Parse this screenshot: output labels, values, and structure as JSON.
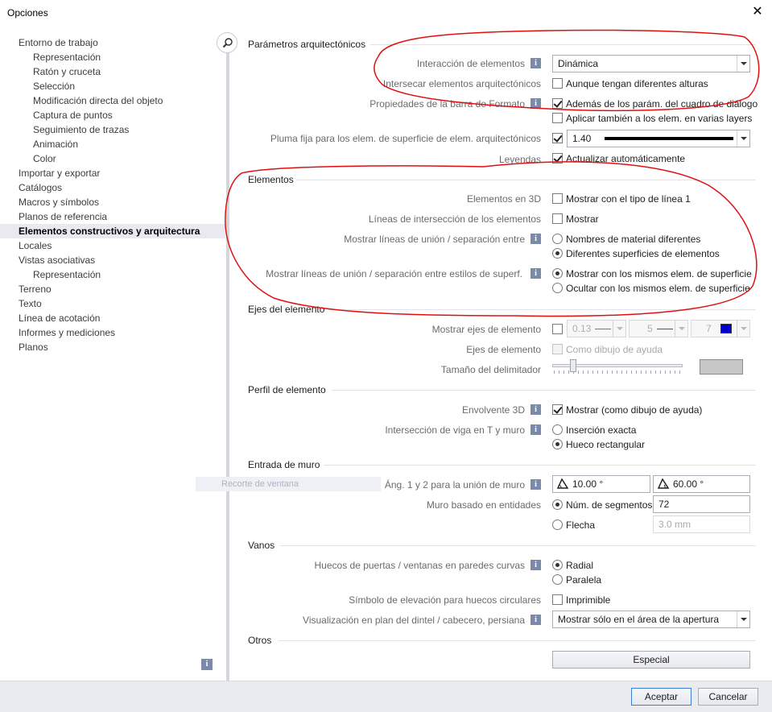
{
  "window": {
    "title": "Opciones",
    "close_glyph": "✕"
  },
  "nav": {
    "items": [
      {
        "label": "Entorno de trabajo",
        "level": 1
      },
      {
        "label": "Representación",
        "level": 2
      },
      {
        "label": "Ratón y cruceta",
        "level": 2
      },
      {
        "label": "Selección",
        "level": 2
      },
      {
        "label": "Modificación directa del objeto",
        "level": 2
      },
      {
        "label": "Captura de puntos",
        "level": 2
      },
      {
        "label": "Seguimiento de trazas",
        "level": 2
      },
      {
        "label": "Animación",
        "level": 2
      },
      {
        "label": "Color",
        "level": 2
      },
      {
        "label": "Importar y exportar",
        "level": 1
      },
      {
        "label": "Catálogos",
        "level": 1
      },
      {
        "label": "Macros y símbolos",
        "level": 1
      },
      {
        "label": "Planos de referencia",
        "level": 1
      },
      {
        "label": "Elementos constructivos y arquitectura",
        "level": 1,
        "selected": true
      },
      {
        "label": "Locales",
        "level": 1
      },
      {
        "label": "Vistas asociativas",
        "level": 1
      },
      {
        "label": "Representación",
        "level": 2
      },
      {
        "label": "Terreno",
        "level": 1
      },
      {
        "label": "Texto",
        "level": 1
      },
      {
        "label": "Línea de acotación",
        "level": 1
      },
      {
        "label": "Informes y mediciones",
        "level": 1
      },
      {
        "label": "Planos",
        "level": 1
      }
    ],
    "info_glyph": "i"
  },
  "ghost": {
    "label": "Recorte de ventana"
  },
  "arch": {
    "section": "Parámetros arquitectónicos",
    "interaccion_label": "Interacción de elementos",
    "interaccion_value": "Dinámica",
    "intersecar_label": "Intersecar elementos arquitectónicos",
    "intersecar_opt": "Aunque tengan diferentes alturas",
    "barra_label": "Propiedades de la barra de Formato",
    "barra_opt1": "Además de los parám. del cuadro de diálogo",
    "barra_opt2": "Aplicar también a los elem. en varias layers",
    "pluma_label": "Pluma fija para los elem. de superficie de elem. arquitectónicos",
    "pluma_value": "1.40",
    "leyendas_label": "Leyendas",
    "leyendas_opt": "Actualizar automáticamente"
  },
  "elementos": {
    "section": "Elementos",
    "e3d_label": "Elementos en 3D",
    "e3d_opt": "Mostrar con el tipo de línea 1",
    "lineas_label": "Líneas de intersección de los elementos",
    "lineas_opt": "Mostrar",
    "union_label": "Mostrar líneas de unión / separación entre",
    "union_opt1": "Nombres de material diferentes",
    "union_opt2": "Diferentes superficies de elementos",
    "estilos_label": "Mostrar líneas de unión / separación entre estilos de superf.",
    "estilos_opt1": "Mostrar con los mismos elem. de superficie",
    "estilos_opt2": "Ocultar con los mismos elem. de superficie"
  },
  "ejes": {
    "section": "Ejes del elemento",
    "mostrar_label": "Mostrar ejes de elemento",
    "pen_value": "0.13",
    "line_value": "5",
    "color_value": "7",
    "color_hex": "#0000cc",
    "ejes_label": "Ejes de elemento",
    "ejes_opt": "Como dibujo de ayuda",
    "delim_label": "Tamaño del delimitador"
  },
  "perfil": {
    "section": "Perfil de elemento",
    "env_label": "Envolvente 3D",
    "env_opt": "Mostrar (como dibujo de ayuda)",
    "viga_label": "Intersección de viga en T y muro",
    "viga_opt1": "Inserción exacta",
    "viga_opt2": "Hueco rectangular"
  },
  "muro": {
    "section": "Entrada de muro",
    "ang_label": "Áng. 1 y 2 para la unión de muro",
    "ang1": "10.00 °",
    "ang2": "60.00 °",
    "basado_label": "Muro basado en entidades",
    "seg_opt": "Núm. de segmentos",
    "seg_value": "72",
    "flecha_opt": "Flecha",
    "flecha_value": "3.0 mm"
  },
  "vanos": {
    "section": "Vanos",
    "huecos_label": "Huecos de puertas / ventanas en paredes curvas",
    "radial": "Radial",
    "paralela": "Paralela",
    "simbolo_label": "Símbolo de elevación para huecos circulares",
    "simbolo_opt": "Imprimible",
    "visual_label": "Visualización en plan del dintel / cabecero, persiana",
    "visual_value": "Mostrar sólo en el área de la apertura"
  },
  "otros": {
    "section": "Otros",
    "especial": "Especial"
  },
  "footer": {
    "accept": "Aceptar",
    "cancel": "Cancelar"
  },
  "colors": {
    "annotation": "#e01010",
    "selection_bg": "#e8eaf0",
    "info_icon": "#7a8aa8"
  }
}
